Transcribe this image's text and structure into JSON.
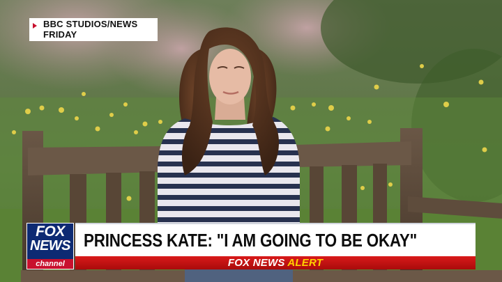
{
  "source_tag": {
    "line1": "BBC STUDIOS/NEWS",
    "line2": "FRIDAY"
  },
  "network_logo": {
    "fox": "FOX",
    "news": "NEWS",
    "channel": "channel"
  },
  "headline": "PRINCESS KATE: \"I AM GOING TO BE OKAY\"",
  "alert_banner": {
    "brand": "FOX NEWS",
    "word": "ALERT"
  },
  "colors": {
    "fox_blue": "#0d2a73",
    "alert_red": "#c8102e",
    "alert_yellow": "#ffd200"
  }
}
